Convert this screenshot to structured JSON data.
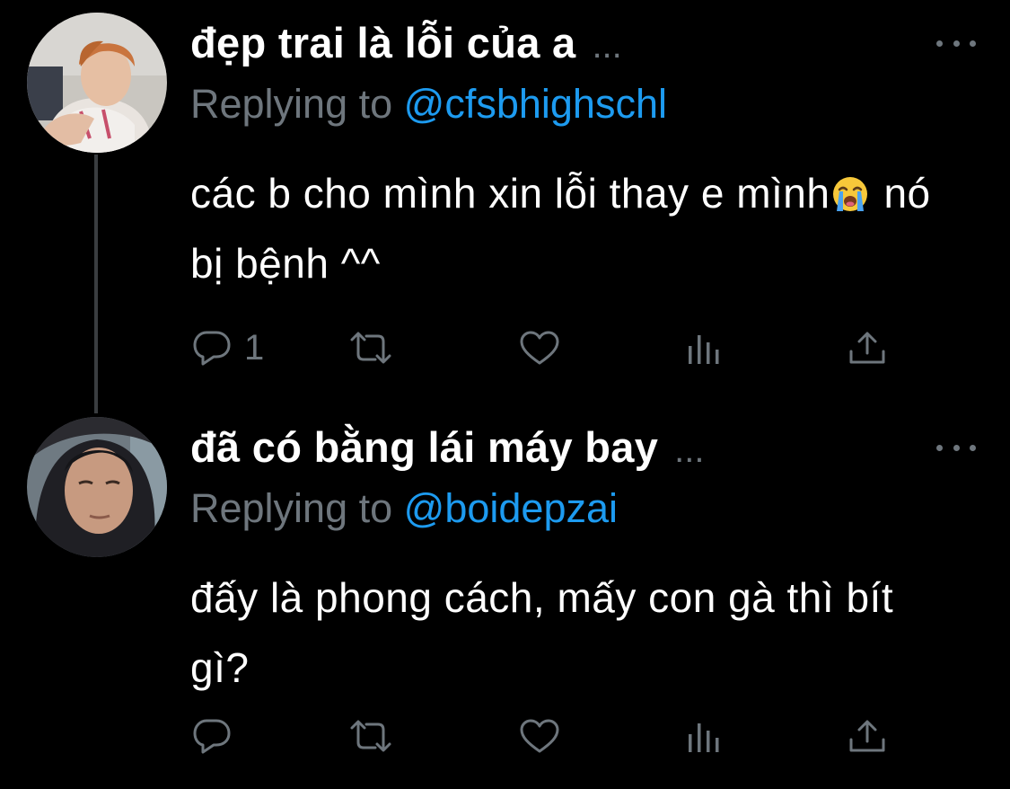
{
  "tweets": [
    {
      "display_name": "đẹp trai là lỗi của a",
      "ellipsis": "...",
      "replying_prefix": "Replying to",
      "replying_handle": "@cfsbhighschl",
      "text_part1": "các b cho mình xin lỗi thay e mình",
      "emoji_icon": "loudly-crying-face-icon",
      "text_part2": "nó bị bệnh ^^",
      "reply_count": "1",
      "avatar_icon": "profile-photo-icon"
    },
    {
      "display_name": "đã có bằng lái máy bay",
      "ellipsis": "...",
      "replying_prefix": "Replying to",
      "replying_handle": "@boidepzai",
      "text": "đấy là phong cách, mấy con gà thì bít gì?",
      "reply_count": "",
      "avatar_icon": "profile-photo-icon"
    }
  ],
  "colors": {
    "background": "#000000",
    "text": "#ffffff",
    "muted": "#6e767d",
    "link": "#1d9bf0",
    "thread_line": "#3a3d40"
  },
  "action_icons": [
    "reply-icon",
    "retweet-icon",
    "like-icon",
    "analytics-icon",
    "share-icon"
  ]
}
